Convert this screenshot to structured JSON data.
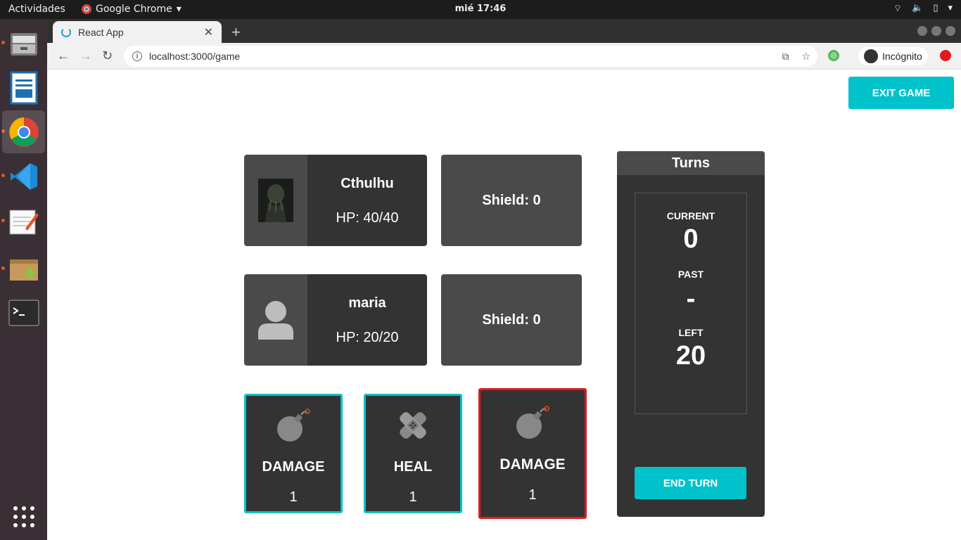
{
  "os": {
    "activities": "Actividades",
    "app_name": "Google Chrome",
    "clock": "mié 17:46"
  },
  "browser": {
    "tab_title": "React App",
    "url": "localhost:3000/game",
    "incognito_label": "Incógnito"
  },
  "game": {
    "exit_label": "EXIT GAME",
    "players": [
      {
        "name": "Cthulhu",
        "hp": "HP: 40/40",
        "shield": "Shield: 0",
        "avatar": "monster-portrait"
      },
      {
        "name": "maria",
        "hp": "HP: 20/20",
        "shield": "Shield: 0",
        "avatar": "default-user-icon"
      }
    ],
    "cards": [
      {
        "title": "DAMAGE",
        "value": "1",
        "icon": "bomb-icon",
        "border_color": "#00c2cb"
      },
      {
        "title": "HEAL",
        "value": "1",
        "icon": "bandage-icon",
        "border_color": "#00c2cb"
      },
      {
        "title": "DAMAGE",
        "value": "1",
        "icon": "bomb-icon",
        "border_color": "#e01b1b"
      }
    ],
    "turns": {
      "title": "Turns",
      "current_label": "CURRENT",
      "current_value": "0",
      "past_label": "PAST",
      "past_value": "-",
      "left_label": "LEFT",
      "left_value": "20",
      "end_turn_label": "END TURN"
    }
  },
  "colors": {
    "accent": "#00c2cb",
    "selected": "#e01b1b",
    "panel_dark": "#333333",
    "panel_mid": "#4a4a4a"
  }
}
